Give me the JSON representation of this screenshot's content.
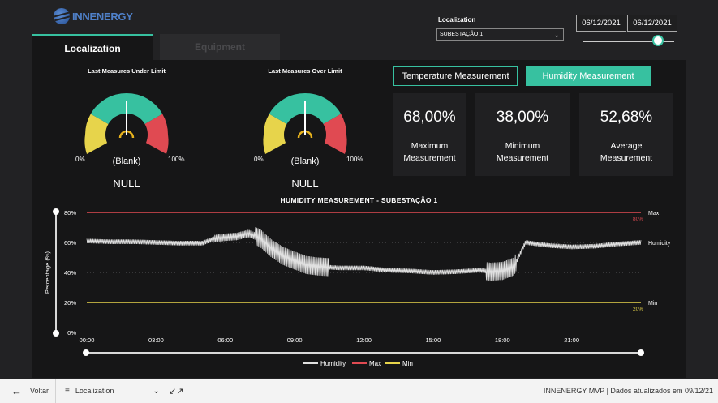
{
  "app": {
    "logo_text": "INNENERGY"
  },
  "tabs": [
    {
      "label": "Localization",
      "active": true
    },
    {
      "label": "Equipment",
      "active": false
    }
  ],
  "filters": {
    "localization_label": "Localization",
    "localization_value": "SUBESTAÇÃO 1",
    "date_start": "06/12/2021",
    "date_end": "06/12/2021"
  },
  "gauges": [
    {
      "title": "Last Measures Under Limit",
      "min_label": "0%",
      "max_label": "100%",
      "center_label": "(Blank)",
      "value_label": "NULL"
    },
    {
      "title": "Last Measures Over Limit",
      "min_label": "0%",
      "max_label": "100%",
      "center_label": "(Blank)",
      "value_label": "NULL"
    }
  ],
  "measurement_buttons": {
    "temperature": "Temperature Measurement",
    "humidity": "Humidity Measurement"
  },
  "kpis": [
    {
      "value": "68,00%",
      "label_line1": "Maximum",
      "label_line2": "Measurement"
    },
    {
      "value": "38,00%",
      "label_line1": "Minimum",
      "label_line2": "Measurement"
    },
    {
      "value": "52,68%",
      "label_line1": "Average",
      "label_line2": "Measurement"
    }
  ],
  "chart_data": {
    "type": "line",
    "title": "HUMIDITY MEASUREMENT - SUBESTAÇÃO 1",
    "ylabel": "Percentage (%)",
    "xlabel": "",
    "x_ticks": [
      "00:00",
      "03:00",
      "06:00",
      "09:00",
      "12:00",
      "15:00",
      "18:00",
      "21:00"
    ],
    "y_ticks": [
      "80%",
      "60%",
      "40%",
      "20%",
      "0%"
    ],
    "ylim": [
      0,
      80
    ],
    "x_range_hours": [
      0,
      24
    ],
    "reference_lines": [
      {
        "name": "Max",
        "value": 80,
        "label": "80%",
        "color": "#e04a52"
      },
      {
        "name": "Min",
        "value": 20,
        "label": "20%",
        "color": "#e7d44b"
      }
    ],
    "series": [
      {
        "name": "Humidity",
        "color": "#e0e0e0",
        "x": [
          0.0,
          1.0,
          2.0,
          3.0,
          4.0,
          5.0,
          5.5,
          6.0,
          6.5,
          7.0,
          7.5,
          8.0,
          8.5,
          9.0,
          9.5,
          10.0,
          10.5,
          11.0,
          12.0,
          13.0,
          14.0,
          15.0,
          16.0,
          17.0,
          17.5,
          18.0,
          18.5,
          19.0,
          20.0,
          21.0,
          22.0,
          23.0,
          24.0
        ],
        "y": [
          61.0,
          60.5,
          60.5,
          60.0,
          59.5,
          59.5,
          62.5,
          63.5,
          64.0,
          66.0,
          63.0,
          56.0,
          51.0,
          48.0,
          45.0,
          44.0,
          43.5,
          43.0,
          43.0,
          41.5,
          41.0,
          40.0,
          40.5,
          41.5,
          40.5,
          41.0,
          44.0,
          60.0,
          58.0,
          57.0,
          57.5,
          59.0,
          60.0
        ]
      },
      {
        "name": "Max",
        "color": "#e04a52",
        "x": [
          0,
          24
        ],
        "y": [
          80,
          80
        ]
      },
      {
        "name": "Min",
        "color": "#e7d44b",
        "x": [
          0,
          24
        ],
        "y": [
          20,
          20
        ]
      }
    ],
    "legend": [
      "Humidity",
      "Max",
      "Min"
    ],
    "legend_position": "bottom-center",
    "right_labels": [
      "Max",
      "Humidity",
      "Min"
    ],
    "grid": true
  },
  "footer": {
    "back_label": "Voltar",
    "page_label": "Localization",
    "status_text": "INNENERGY MVP  |  Dados atualizados em 09/12/21"
  },
  "colors": {
    "accent": "#37c1a0",
    "gauge_green": "#37c1a0",
    "gauge_yellow": "#e7d44b",
    "gauge_red": "#e04a52"
  },
  "icons": [
    "back-arrow-icon",
    "hamburger-icon",
    "chevron-down-icon",
    "collapse-icon"
  ]
}
